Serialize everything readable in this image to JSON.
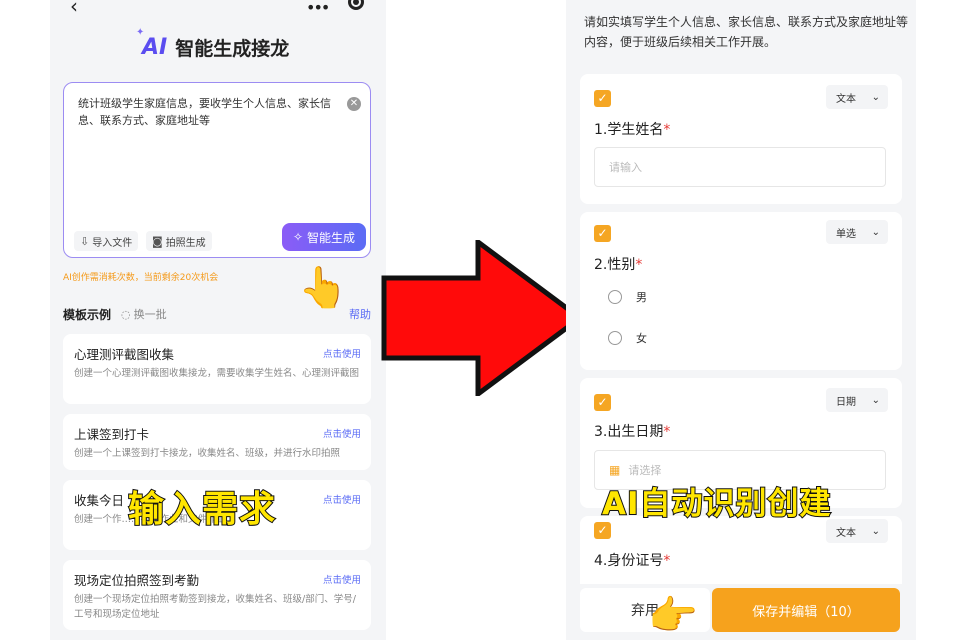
{
  "left": {
    "header": {
      "badge": "AI",
      "title": "智能生成接龙"
    },
    "input": {
      "value": "统计班级学生家庭信息，要收学生个人信息、家长信息、联系方式、家庭地址等",
      "import_label": "导入文件",
      "photo_label": "拍照生成",
      "generate_label": "智能生成"
    },
    "quota_text": "AI创作需消耗次数，当前剩余20次机会",
    "templates": {
      "title": "模板示例",
      "refresh_label": "换一批",
      "help_label": "帮助",
      "use_label": "点击使用",
      "items": [
        {
          "name": "心理测评截图收集",
          "desc": "创建一个心理测评截图收集接龙，需要收集学生姓名、心理测评截图"
        },
        {
          "name": "上课签到打卡",
          "desc": "创建一个上课签到打卡接龙，收集姓名、班级，并进行水印拍照"
        },
        {
          "name": "收集今日",
          "desc": "创建一个作……视频作业和文件作业"
        },
        {
          "name": "现场定位拍照签到考勤",
          "desc": "创建一个现场定位拍照考勤签到接龙，收集姓名、班级/部门、学号/工号和现场定位地址"
        }
      ]
    }
  },
  "right": {
    "intro": "请如实填写学生个人信息、家长信息、联系方式及家庭地址等内容，便于班级后续相关工作开展。",
    "fields": [
      {
        "type_label": "文本",
        "label": "1.学生姓名",
        "placeholder": "请输入"
      },
      {
        "type_label": "单选",
        "label": "2.性别",
        "options": [
          "男",
          "女"
        ]
      },
      {
        "type_label": "日期",
        "label": "3.出生日期",
        "placeholder": "请选择"
      },
      {
        "type_label": "文本",
        "label": "4.身份证号"
      }
    ],
    "cancel_label": "弃用",
    "save_label": "保存并编辑（10）"
  },
  "overlay": {
    "left_caption": "输入需求",
    "right_caption": "AI自动识别创建"
  },
  "colors": {
    "accent_purple": "#8b5cf6",
    "accent_orange": "#f6a21d",
    "arrow_red": "#ff0a0a",
    "caption_yellow": "#ffe600"
  },
  "icons": [
    "back-icon",
    "more-icon",
    "target-icon",
    "clear-icon",
    "import-file-icon",
    "camera-icon",
    "sparkle-icon",
    "refresh-icon",
    "checkbox-icon",
    "chevron-down-icon",
    "calendar-icon",
    "pointing-hand-icon"
  ]
}
